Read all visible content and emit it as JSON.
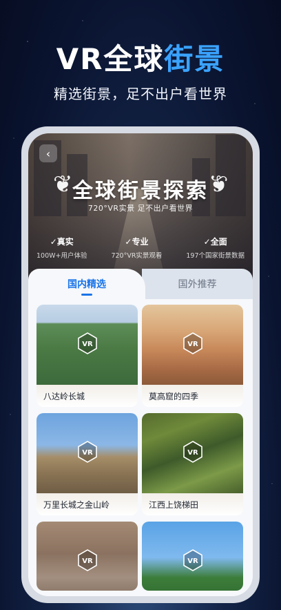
{
  "promo": {
    "headline_part1": "VR全球",
    "headline_accent": "街景",
    "subheadline": "精选街景，足不出户看世界"
  },
  "app": {
    "back_icon": "chevron-left-icon",
    "hero": {
      "title": "全球街景探索",
      "subtitle": "720°VR实景 足不出户看世界",
      "features": [
        {
          "title": "✓真实",
          "desc": "100W+用户体验"
        },
        {
          "title": "✓专业",
          "desc": "720°VR实景观看"
        },
        {
          "title": "✓全面",
          "desc": "197个国家街景数据"
        }
      ]
    },
    "tabs": [
      {
        "label": "国内精选",
        "active": true
      },
      {
        "label": "国外推荐",
        "active": false
      }
    ],
    "badge_text": "VR",
    "cards": [
      {
        "label": "八达岭长城"
      },
      {
        "label": "莫高窟的四季"
      },
      {
        "label": "万里长城之金山岭"
      },
      {
        "label": "江西上饶梯田"
      },
      {
        "label": ""
      },
      {
        "label": ""
      }
    ]
  },
  "colors": {
    "accent": "#3aa3ff",
    "tab_active": "#1a74e8",
    "background": "#0a1430"
  }
}
